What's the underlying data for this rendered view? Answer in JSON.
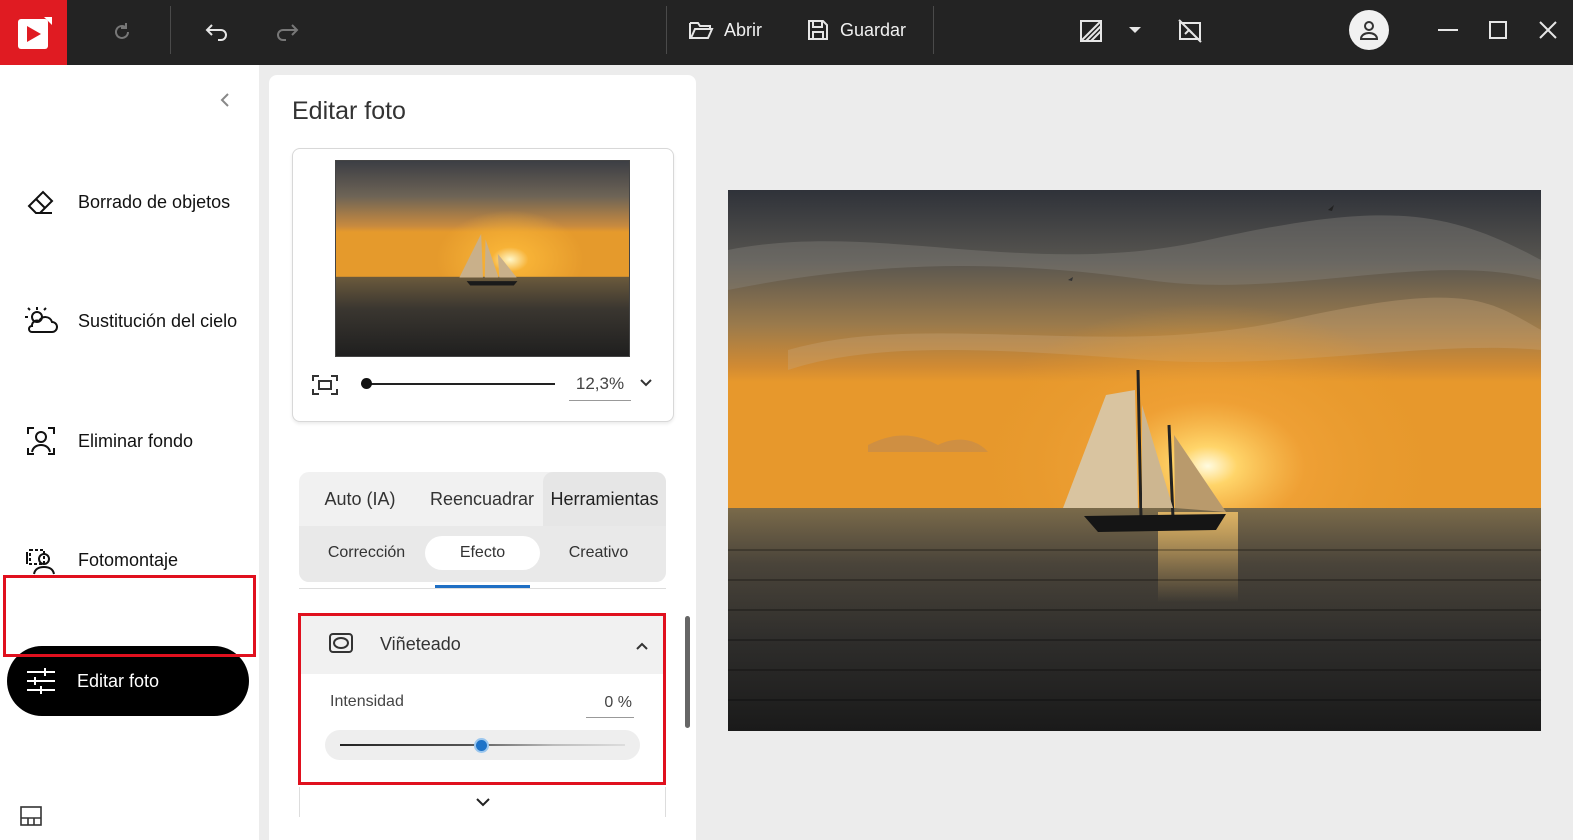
{
  "app": {
    "logo_icon": "play-logo-icon",
    "accent_color": "#e01b22"
  },
  "toolbar": {
    "reset_icon": "refresh-icon",
    "undo_icon": "undo-icon",
    "redo_icon": "redo-icon",
    "open_label": "Abrir",
    "open_icon": "folder-open-icon",
    "save_label": "Guardar",
    "save_icon": "save-icon",
    "compare_icon": "split-view-icon",
    "compare_dropdown_icon": "caret-down-icon",
    "crop_off_icon": "no-crop-icon",
    "account_icon": "user-icon",
    "minimize_icon": "minimize-icon",
    "maximize_icon": "maximize-icon",
    "close_icon": "close-icon"
  },
  "sidebar": {
    "collapse_icon": "chevron-left-icon",
    "items": [
      {
        "label": "Borrado de objetos",
        "icon": "eraser-icon"
      },
      {
        "label": "Sustitución del cielo",
        "icon": "sky-cloud-icon"
      },
      {
        "label": "Eliminar fondo",
        "icon": "person-frame-icon"
      },
      {
        "label": "Fotomontaje",
        "icon": "photomontage-icon"
      }
    ],
    "active_item": {
      "label": "Editar foto",
      "icon": "sliders-icon"
    },
    "bottom_icon": "layout-panel-icon",
    "highlight_color": "#e0101e"
  },
  "panel": {
    "title": "Editar foto",
    "zoom": {
      "value": "12,3%",
      "level_fraction": 0.0
    },
    "tabs": [
      {
        "label": "Auto (IA)"
      },
      {
        "label": "Reencuadrar"
      },
      {
        "label": "Herramientas",
        "active": true
      }
    ],
    "subtabs": [
      {
        "label": "Corrección"
      },
      {
        "label": "Efecto",
        "active": true
      },
      {
        "label": "Creativo"
      }
    ],
    "vignette": {
      "title": "Viñeteado",
      "icon": "vignette-icon",
      "expanded": true,
      "intensity_label": "Intensidad",
      "intensity_value": "0 %",
      "slider_level": 0.5,
      "slider_color": "#1e73c8"
    },
    "more_icon": "chevron-down-icon"
  }
}
